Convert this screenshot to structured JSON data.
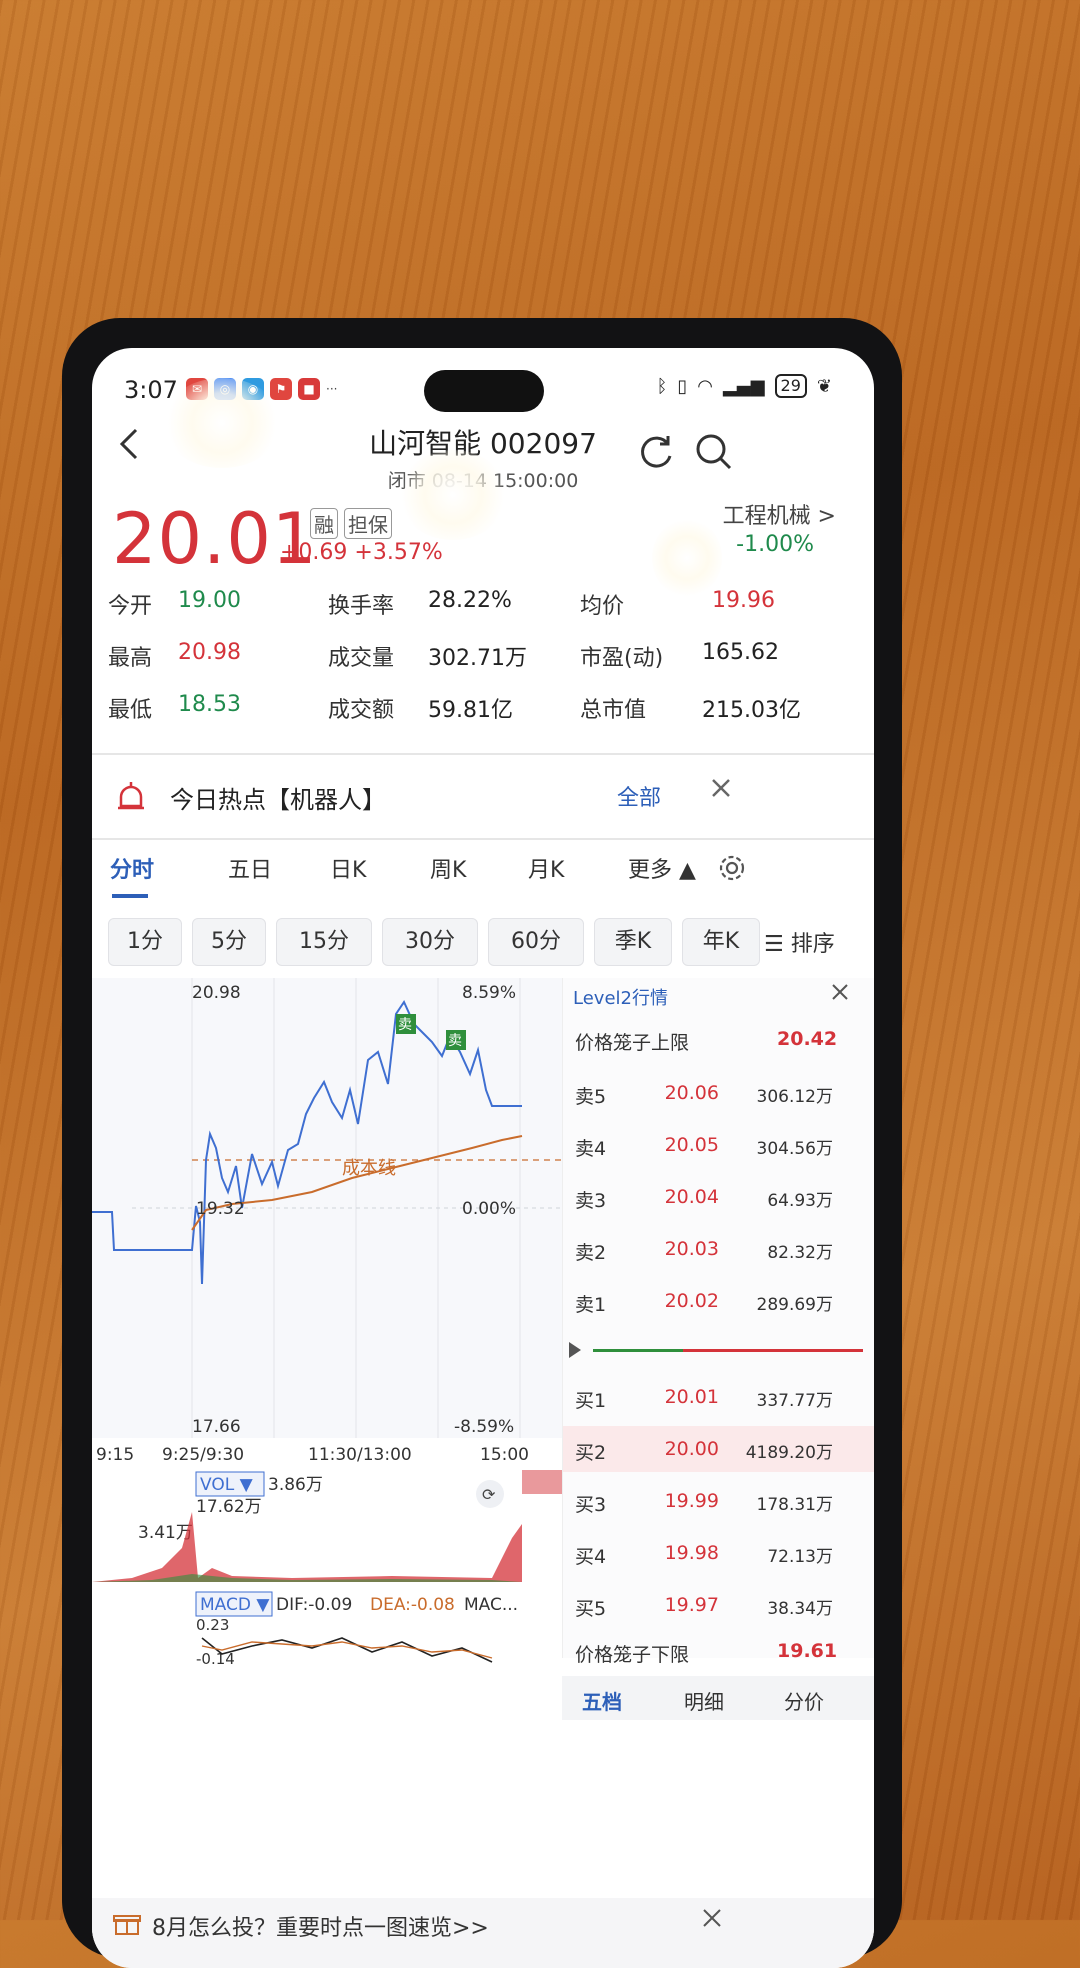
{
  "status_bar": {
    "time": "3:07",
    "more": "···",
    "battery": "29"
  },
  "header": {
    "title": "山河智能 002097",
    "subtitle": "闭市 08-14 15:00:00"
  },
  "quote": {
    "price": "20.01",
    "badge_margin": "融",
    "badge_collateral": "担保",
    "change": "+0.69  +3.57%",
    "sector_name": "工程机械 >",
    "sector_change": "-1.00%"
  },
  "stats": [
    {
      "label": "今开",
      "value": "19.00",
      "color": "#1f8a4c"
    },
    {
      "label": "换手率",
      "value": "28.22%",
      "color": "#222222"
    },
    {
      "label": "均价",
      "value": "19.96",
      "color": "#d4333a"
    },
    {
      "label": "最高",
      "value": "20.98",
      "color": "#d4333a"
    },
    {
      "label": "成交量",
      "value": "302.71万",
      "color": "#222222"
    },
    {
      "label": "市盈(动)",
      "value": "165.62",
      "color": "#222222"
    },
    {
      "label": "最低",
      "value": "18.53",
      "color": "#1f8a4c"
    },
    {
      "label": "成交额",
      "value": "59.81亿",
      "color": "#222222"
    },
    {
      "label": "总市值",
      "value": "215.03亿",
      "color": "#222222"
    }
  ],
  "hot_topic": {
    "title": "今日热点【机器人】",
    "all": "全部"
  },
  "tabs": [
    "分时",
    "五日",
    "日K",
    "周K",
    "月K",
    "更多 ▲"
  ],
  "periods": [
    "1分",
    "5分",
    "15分",
    "30分",
    "60分",
    "季K",
    "年K",
    "☰ 排序"
  ],
  "chart": {
    "price_max": "20.98",
    "price_min": "17.66",
    "price_mid": "19.32",
    "pct_max": "8.59%",
    "pct_zero": "0.00%",
    "pct_min": "-8.59%",
    "cost_line_label": "成本线",
    "sell_marker": "卖",
    "time_axis": [
      "9:15",
      "9:25/9:30",
      "11:30/13:00",
      "15:00"
    ],
    "vol_label": "VOL ▼",
    "vol_value": "3.86万",
    "vol_max": "17.62万",
    "vol_open": "3.41万",
    "macd_label": "MACD ▼",
    "dif": "DIF:-0.09",
    "dea": "DEA:-0.08",
    "macd_more": "MAC...",
    "macd_top": "0.23",
    "macd_bottom": "-0.14"
  },
  "level2": {
    "title": "Level2行情",
    "upper_limit_label": "价格笼子上限",
    "upper_limit": "20.42",
    "asks": [
      {
        "label": "卖5",
        "price": "20.06",
        "qty": "306.12万"
      },
      {
        "label": "卖4",
        "price": "20.05",
        "qty": "304.56万"
      },
      {
        "label": "卖3",
        "price": "20.04",
        "qty": "64.93万"
      },
      {
        "label": "卖2",
        "price": "20.03",
        "qty": "82.32万"
      },
      {
        "label": "卖1",
        "price": "20.02",
        "qty": "289.69万"
      }
    ],
    "bids": [
      {
        "label": "买1",
        "price": "20.01",
        "qty": "337.77万"
      },
      {
        "label": "买2",
        "price": "20.00",
        "qty": "4189.20万"
      },
      {
        "label": "买3",
        "price": "19.99",
        "qty": "178.31万"
      },
      {
        "label": "买4",
        "price": "19.98",
        "qty": "72.13万"
      },
      {
        "label": "买5",
        "price": "19.97",
        "qty": "38.34万"
      }
    ],
    "lower_limit_label": "价格笼子下限",
    "lower_limit": "19.61",
    "bottom_tabs": [
      "五档",
      "明细",
      "分价"
    ]
  },
  "banner": {
    "text": "8月怎么投？重要时点一图速览>>"
  }
}
